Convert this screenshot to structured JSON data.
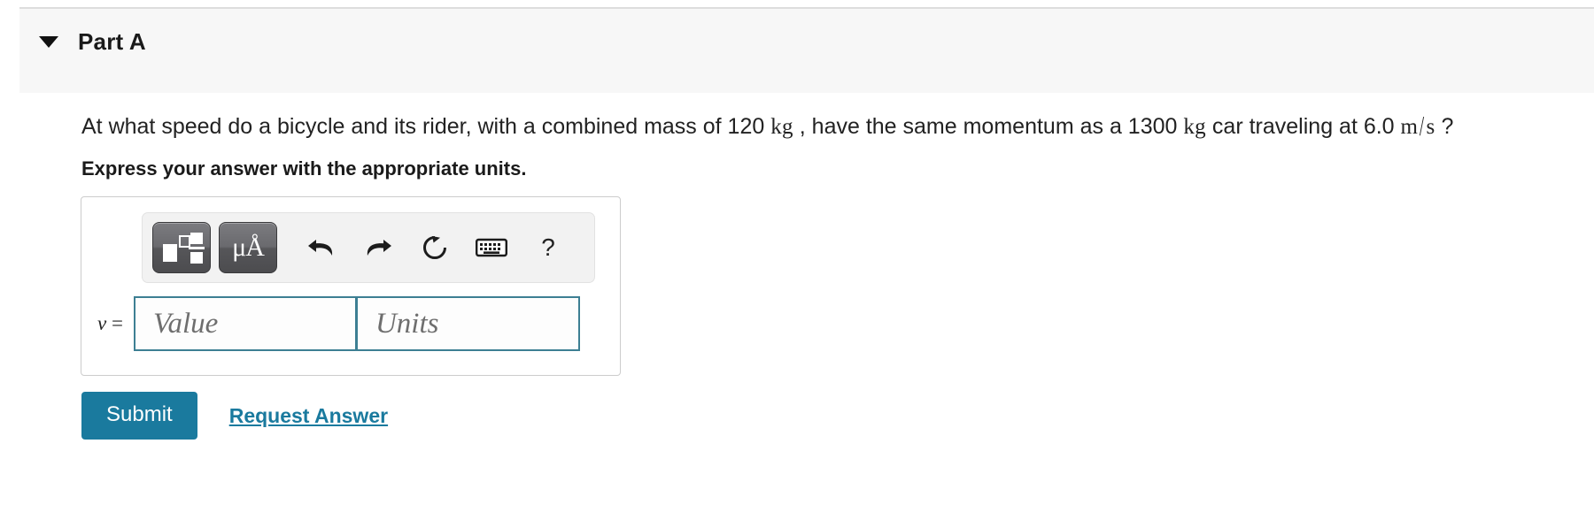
{
  "part": {
    "title": "Part A",
    "caret_icon": "caret-down-icon",
    "collapsed": false
  },
  "question": {
    "segment_1": "At what speed do a bicycle and its rider, with a combined mass of 120",
    "unit_1": "kg",
    "segment_2": ", have the same momentum as a 1300",
    "unit_2": "kg",
    "segment_3": "car traveling at 6.0",
    "unit_3_numerator": "m",
    "unit_3_slash": "/",
    "unit_3_denominator": "s",
    "segment_4": "?"
  },
  "instruction": "Express your answer with the appropriate units.",
  "toolbar": {
    "buttons": [
      {
        "name": "math-template-button",
        "label": "",
        "icon": "math-template-icon",
        "pressed": true
      },
      {
        "name": "units-button",
        "label": "μÅ",
        "icon": "micro-angstrom-icon",
        "pressed": true
      },
      {
        "name": "undo-button",
        "label": "",
        "icon": "undo-arrow-icon",
        "pressed": false
      },
      {
        "name": "redo-button",
        "label": "",
        "icon": "redo-arrow-icon",
        "pressed": false
      },
      {
        "name": "reset-button",
        "label": "",
        "icon": "reset-circular-arrow-icon",
        "pressed": false
      },
      {
        "name": "keyboard-button",
        "label": "",
        "icon": "keyboard-icon",
        "pressed": false
      },
      {
        "name": "help-button",
        "label": "?",
        "icon": "question-mark-icon",
        "pressed": false
      }
    ]
  },
  "answer": {
    "variable_label": "v",
    "equals": "=",
    "value_field": {
      "value": "",
      "placeholder": "Value"
    },
    "units_field": {
      "value": "",
      "placeholder": "Units"
    }
  },
  "actions": {
    "submit_label": "Submit",
    "request_answer_label": "Request Answer"
  },
  "colors": {
    "accent_teal": "#1a7a9e",
    "input_border": "#3d7f93",
    "header_background": "#f7f7f7",
    "toolbar_background": "#f2f2f2",
    "button_gray": "#6a6a6e"
  }
}
